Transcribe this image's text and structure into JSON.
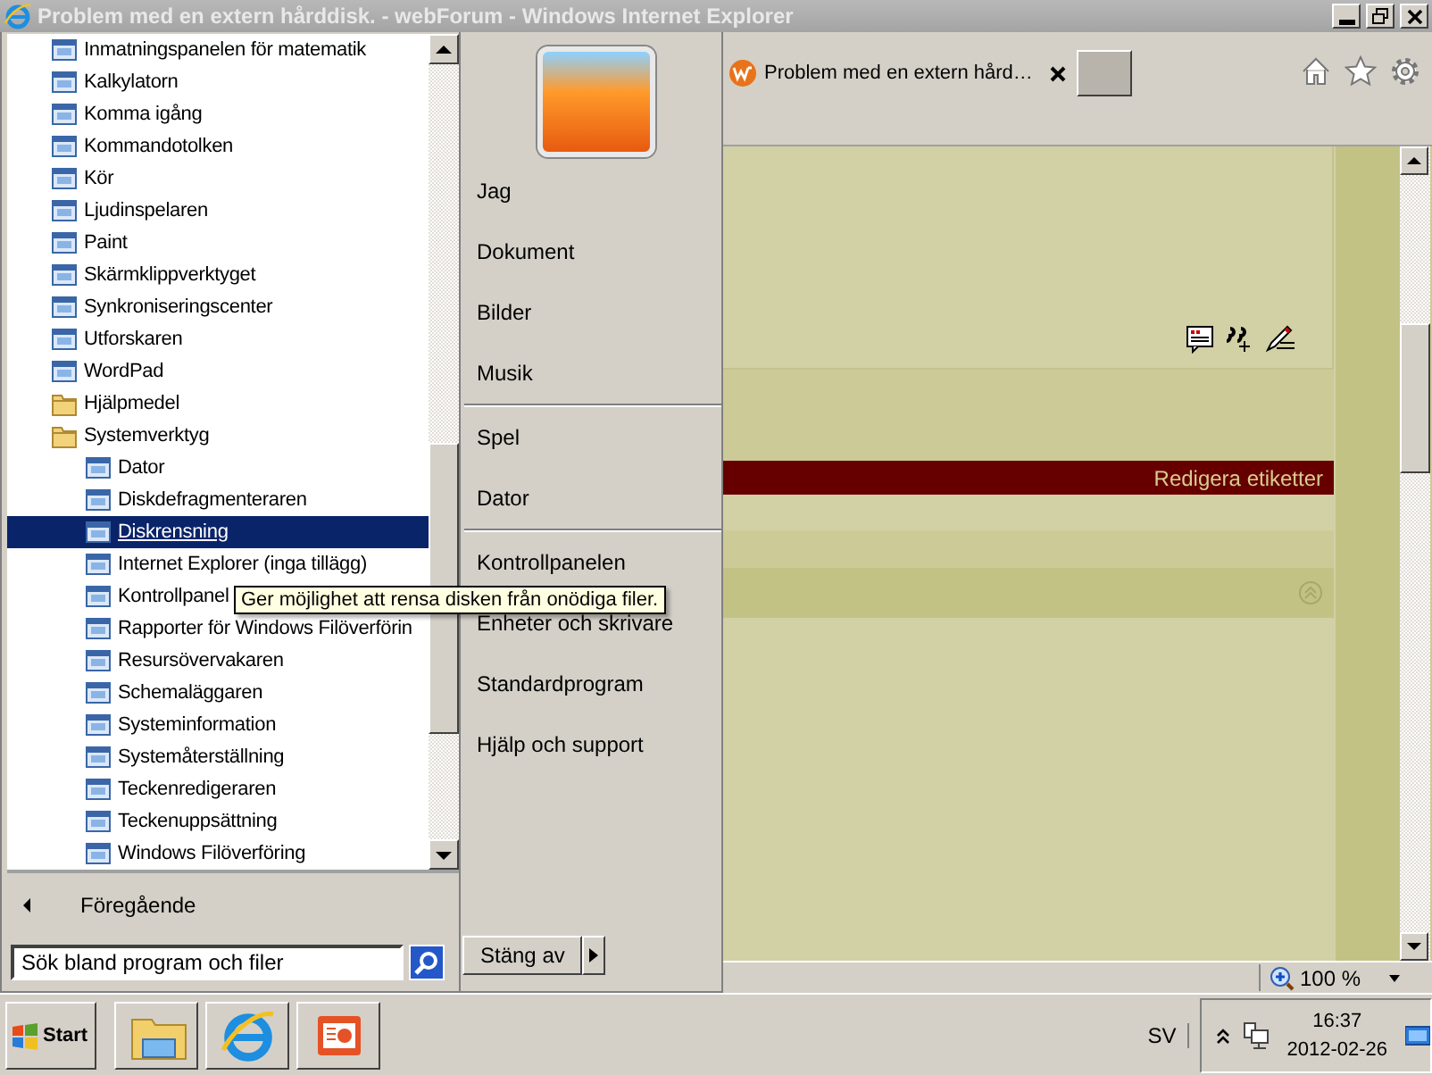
{
  "window": {
    "title": "Problem med en extern hårddisk. - webForum - Windows Internet Explorer"
  },
  "browser": {
    "tab": {
      "title": "Problem med en extern hård…",
      "selected": true
    },
    "post_bar": {
      "label": "Redigera etiketter"
    },
    "status_bar": {
      "zoom": "100 %"
    }
  },
  "start_menu": {
    "programs": [
      {
        "label": "Inmatningspanelen för matematik",
        "kind": "app",
        "selected": false
      },
      {
        "label": "Kalkylatorn",
        "kind": "app",
        "selected": false
      },
      {
        "label": "Komma igång",
        "kind": "app",
        "selected": false
      },
      {
        "label": "Kommandotolken",
        "kind": "app",
        "selected": false
      },
      {
        "label": "Kör",
        "kind": "app",
        "selected": false
      },
      {
        "label": "Ljudinspelaren",
        "kind": "app",
        "selected": false
      },
      {
        "label": "Paint",
        "kind": "app",
        "selected": false
      },
      {
        "label": "Skärmklippverktyget",
        "kind": "app",
        "selected": false
      },
      {
        "label": "Synkroniseringscenter",
        "kind": "app",
        "selected": false
      },
      {
        "label": "Utforskaren",
        "kind": "app",
        "selected": false
      },
      {
        "label": "WordPad",
        "kind": "app",
        "selected": false
      },
      {
        "label": "Hjälpmedel",
        "kind": "folder",
        "selected": false
      },
      {
        "label": "Systemverktyg",
        "kind": "folder",
        "selected": false,
        "children": [
          {
            "label": "Dator",
            "kind": "app",
            "selected": false
          },
          {
            "label": "Diskdefragmenteraren",
            "kind": "app",
            "selected": false
          },
          {
            "label": "Diskrensning",
            "kind": "app",
            "selected": true
          },
          {
            "label": "Internet Explorer (inga tillägg)",
            "kind": "app",
            "selected": false
          },
          {
            "label": "Kontrollpanel",
            "kind": "app",
            "selected": false
          },
          {
            "label": "Rapporter för Windows Filöverförin",
            "kind": "app",
            "selected": false
          },
          {
            "label": "Resursövervakaren",
            "kind": "app",
            "selected": false
          },
          {
            "label": "Schemaläggaren",
            "kind": "app",
            "selected": false
          },
          {
            "label": "Systeminformation",
            "kind": "app",
            "selected": false
          },
          {
            "label": "Systemåterställning",
            "kind": "app",
            "selected": false
          },
          {
            "label": "Teckenredigeraren",
            "kind": "app",
            "selected": false
          },
          {
            "label": "Teckenuppsättning",
            "kind": "app",
            "selected": false
          },
          {
            "label": "Windows Filöverföring",
            "kind": "app",
            "selected": false
          }
        ]
      }
    ],
    "tooltip": "Ger möjlighet att rensa disken från onödiga filer.",
    "back_label": "Föregående",
    "search": {
      "placeholder": "Sök bland program och filer"
    },
    "right_groups": [
      [
        "Jag",
        "Dokument",
        "Bilder",
        "Musik"
      ],
      [
        "Spel",
        "Dator"
      ],
      [
        "Kontrollpanelen",
        "Enheter och skrivare",
        "Standardprogram",
        "Hjälp och support"
      ]
    ],
    "shutdown": "Stäng av"
  },
  "taskbar": {
    "start": "Start",
    "language": "SV",
    "time": "16:37",
    "date": "2012-02-26"
  }
}
